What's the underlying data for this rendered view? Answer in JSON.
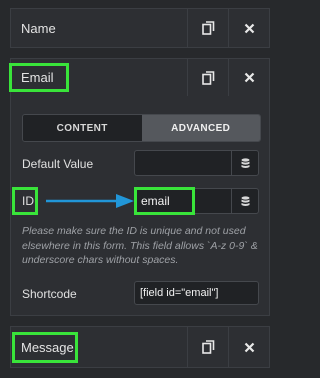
{
  "fields": {
    "name": {
      "label": "Name"
    },
    "email": {
      "label": "Email"
    },
    "message": {
      "label": "Message"
    }
  },
  "icons": {
    "duplicate": "duplicate-icon",
    "close": "close-icon",
    "database": "database-icon",
    "arrow": "arrow-right-icon"
  },
  "colors": {
    "highlight": "#39e43a",
    "arrow": "#2196d8",
    "active_tab": "#55585d"
  },
  "tabs": {
    "content": "CONTENT",
    "advanced": "ADVANCED",
    "active": "ADVANCED"
  },
  "settings": {
    "default_value_label": "Default Value",
    "default_value": "",
    "id_label": "ID",
    "id_value": "email",
    "help_text": "Please make sure the ID is unique and not used elsewhere in this form. This field allows `A-z 0-9` & underscore chars without spaces.",
    "shortcode_label": "Shortcode",
    "shortcode_value": "[field id=\"email\"]"
  }
}
